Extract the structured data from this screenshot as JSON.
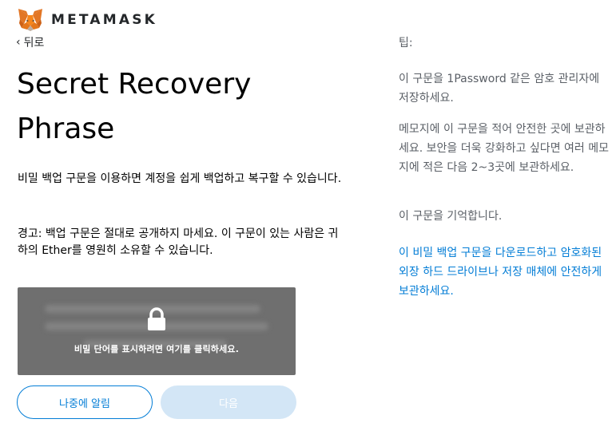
{
  "header": {
    "brand": "METAMASK",
    "logo_icon": "metamask-fox-icon"
  },
  "nav": {
    "back_label": "뒤로",
    "back_icon": "chevron-left-icon"
  },
  "main": {
    "title": "Secret Recovery Phrase",
    "description": "비밀 백업 구문을 이용하면 계정을 쉽게 백업하고 복구할 수 있습니다.",
    "warning": "경고: 백업 구문은 절대로 공개하지 마세요. 이 구문이 있는 사람은 귀하의 Ether를 영원히 소유할 수 있습니다.",
    "reveal": {
      "label": "비밀 단어를 표시하려면 여기를 클릭하세요.",
      "icon": "lock-icon"
    },
    "buttons": {
      "remind_later": "나중에 알림",
      "next": "다음"
    }
  },
  "tips": {
    "title": "팁:",
    "items": [
      "이 구문을 1Password 같은 암호 관리자에 저장하세요.",
      "메모지에 이 구문을 적어 안전한 곳에 보관하세요. 보안을 더욱 강화하고 싶다면 여러 메모지에 적은 다음 2~3곳에 보관하세요.",
      "이 구문을 기억합니다."
    ],
    "download_link": "이 비밀 백업 구문을 다운로드하고 암호화된 외장 하드 드라이브나 저장 매체에 안전하게 보관하세요."
  },
  "colors": {
    "accent": "#037dd6",
    "reveal_bg": "#6f6f6f",
    "next_disabled": "#d3e6f6",
    "muted_text": "#5a5f66"
  }
}
